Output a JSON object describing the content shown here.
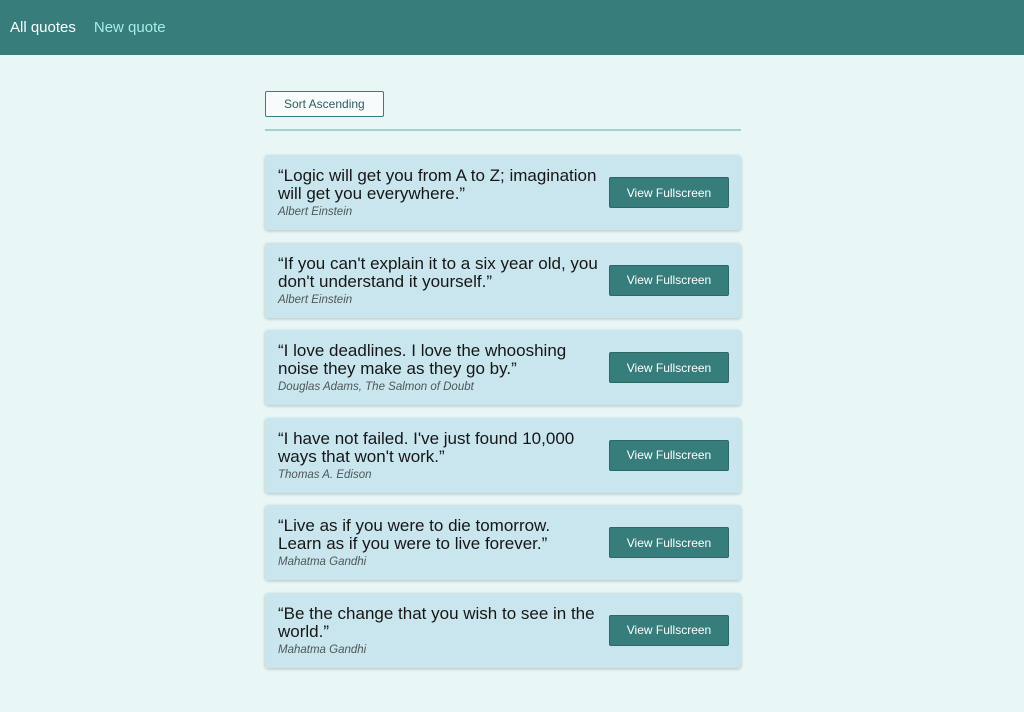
{
  "nav": {
    "all_quotes": "All quotes",
    "new_quote": "New quote"
  },
  "toolbar": {
    "sort_label": "Sort Ascending"
  },
  "quotes": [
    {
      "text": "“Logic will get you from A to Z; imagination will get you everywhere.”",
      "author": "Albert Einstein",
      "button_label": "View Fullscreen"
    },
    {
      "text": "“If you can't explain it to a six year old, you don't understand it yourself.”",
      "author": "Albert Einstein",
      "button_label": "View Fullscreen"
    },
    {
      "text": "“I love deadlines. I love the whooshing noise they make as they go by.”",
      "author": "Douglas Adams, The Salmon of Doubt",
      "button_label": "View Fullscreen"
    },
    {
      "text": "“I have not failed. I've just found 10,000 ways that won't work.”",
      "author": "Thomas A. Edison",
      "button_label": "View Fullscreen"
    },
    {
      "text": "“Live as if you were to die tomorrow. Learn as if you were to live forever.”",
      "author": "Mahatma Gandhi",
      "button_label": "View Fullscreen"
    },
    {
      "text": "“Be the change that you wish to see in the world.”",
      "author": "Mahatma Gandhi",
      "button_label": "View Fullscreen"
    }
  ],
  "colors": {
    "header": "#367d7b",
    "background": "#e8f6f6",
    "card": "#c9e6ee",
    "accent": "#367d7b",
    "nav_inactive": "#a6eee8"
  }
}
